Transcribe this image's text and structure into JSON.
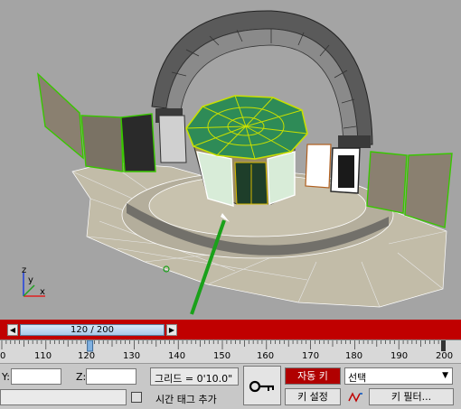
{
  "timeline": {
    "slider_label": "120 / 200",
    "prev_arrow": "◀",
    "next_arrow": "▶",
    "ticks": [
      "0",
      "110",
      "120",
      "130",
      "140",
      "150",
      "160",
      "170",
      "180",
      "190",
      "200"
    ]
  },
  "status": {
    "y_label": "Y:",
    "z_label": "Z:",
    "grid_text": "그리드 = 0'10.0\"",
    "add_time_tag": "시간 태그 추가",
    "auto_key": "자동 키",
    "selection_dropdown": "선택",
    "set_key": "키 설정",
    "key_filter": "키 필터..."
  },
  "axis": {
    "x": "x",
    "y": "y",
    "z": "z"
  },
  "colors": {
    "timebar": "#c00000",
    "auto_key_active": "#b00000",
    "selection": "#39c600",
    "glass": "#2e8b57"
  }
}
